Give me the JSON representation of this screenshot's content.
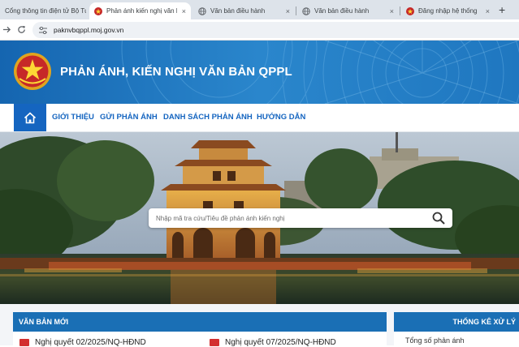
{
  "browser": {
    "tabs": [
      {
        "label": "Cổng thông tin điện tử Bộ Tư pháp",
        "active": false
      },
      {
        "label": "Phản ánh kiến nghị văn bản QPPL",
        "active": true
      },
      {
        "label": "Văn bản điều hành",
        "active": false
      },
      {
        "label": "Văn bản điều hành",
        "active": false
      },
      {
        "label": "Đăng nhập hệ thống",
        "active": false
      }
    ],
    "close_glyph": "×",
    "new_tab_glyph": "+",
    "url": "paknvbqppl.moj.gov.vn"
  },
  "site": {
    "title": "PHẢN ÁNH, KIẾN NGHỊ VĂN BẢN QPPL",
    "brand_color": "#1a73bd"
  },
  "nav": {
    "items": [
      "GIỚI THIỆU",
      "GỬI PHẢN ÁNH",
      "DANH SÁCH PHẢN ÁNH",
      "HƯỚNG DẪN"
    ],
    "home_icon": "home-icon"
  },
  "search": {
    "placeholder": "Nhập mã tra cứu/Tiêu đề phản ánh kiến nghị"
  },
  "panels": {
    "new_docs": {
      "title": "VĂN BẢN MỚI",
      "items": [
        "Nghị quyết 02/2025/NQ-HĐND",
        "Nghị quyết 07/2025/NQ-HĐND"
      ]
    },
    "stats": {
      "title": "THỐNG KÊ XỬ LÝ",
      "first_stat": "Tổng số phản ánh"
    }
  }
}
